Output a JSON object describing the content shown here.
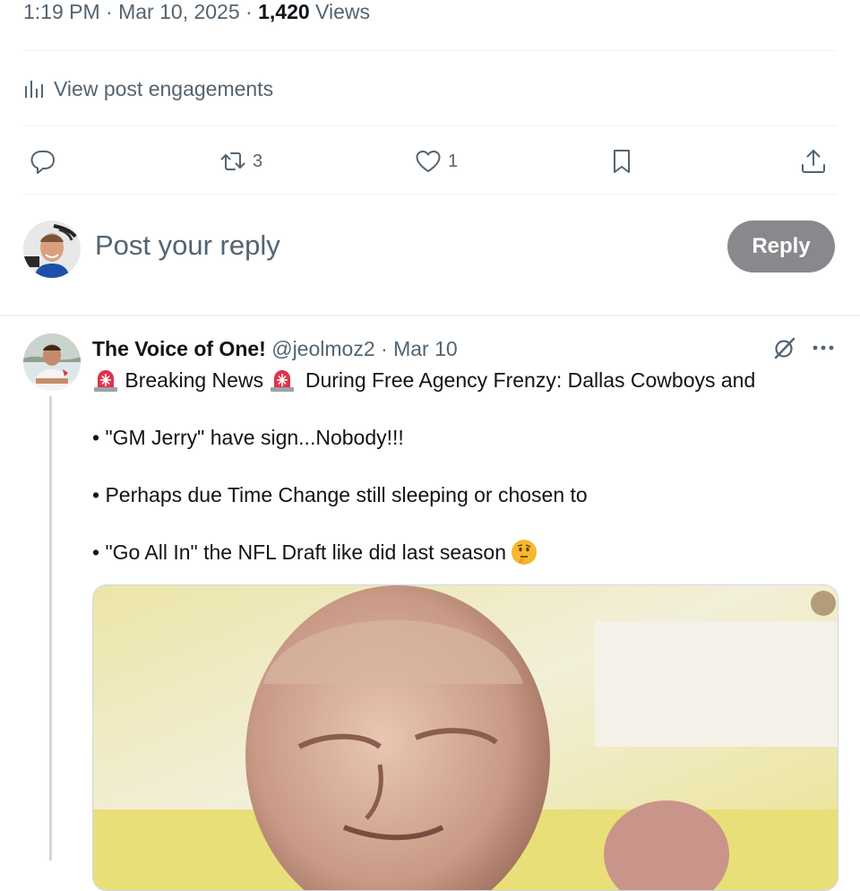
{
  "meta": {
    "time": "1:19 PM",
    "sep1": "·",
    "date": "Mar 10, 2025",
    "sep2": "·",
    "views_count": "1,420",
    "views_label": "Views"
  },
  "engagements": {
    "label": "View post engagements",
    "icon": "bar-chart-icon"
  },
  "actions": {
    "reply": {
      "icon": "reply-icon",
      "count": ""
    },
    "repost": {
      "icon": "repost-icon",
      "count": "3"
    },
    "like": {
      "icon": "heart-icon",
      "count": "1"
    },
    "bookmark": {
      "icon": "bookmark-icon",
      "count": ""
    },
    "share": {
      "icon": "share-icon",
      "count": ""
    }
  },
  "compose": {
    "placeholder": "Post your reply",
    "button": "Reply"
  },
  "post": {
    "name": "The Voice of One!",
    "handle": "@jeolmoz2",
    "sep": "·",
    "date": "Mar 10",
    "line1_a": "Breaking News",
    "line1_b": "During Free Agency Frenzy: Dallas Cowboys and",
    "line2": "• \"GM Jerry\" have sign...Nobody!!!",
    "line3": "• Perhaps due Time Change still sleeping or chosen to",
    "line4": "• \"Go All In\" the NFL Draft like did last season"
  },
  "colors": {
    "text": "#0f1419",
    "secondary": "#536471",
    "reply_button": "#87898c",
    "divider": "#eff3f4"
  }
}
